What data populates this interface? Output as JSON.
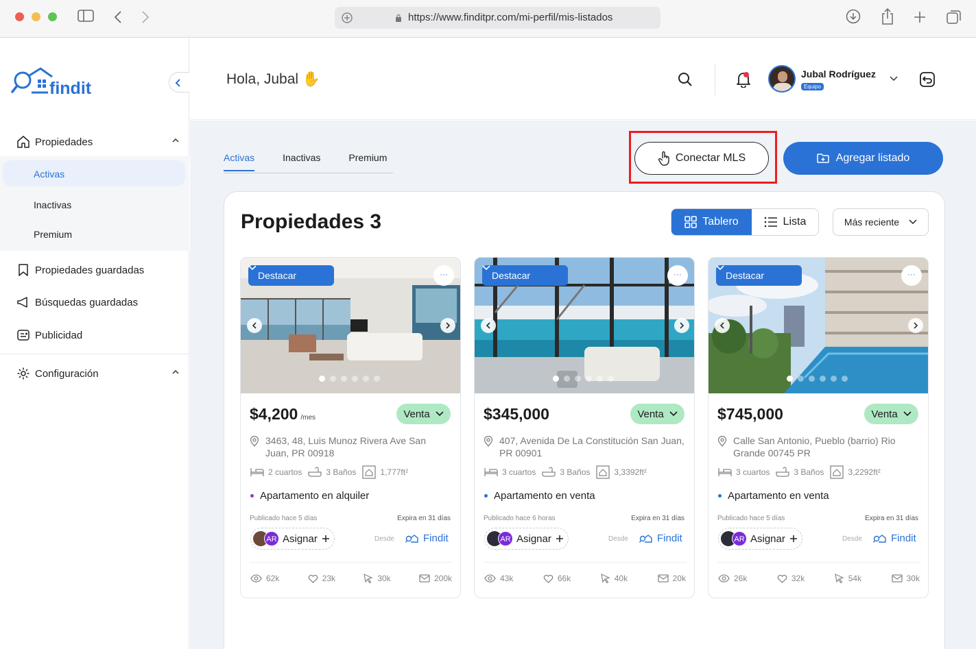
{
  "browser": {
    "url": "https://www.finditpr.com/mi-perfil/mis-listados"
  },
  "sidebar": {
    "logo_text": "findit",
    "nav": {
      "propiedades": "Propiedades",
      "sub": [
        "Activas",
        "Inactivas",
        "Premium"
      ],
      "guardadas": "Propiedades guardadas",
      "busquedas": "Búsquedas guardadas",
      "publicidad": "Publicidad",
      "config": "Configuración"
    }
  },
  "header": {
    "greeting": "Hola, Jubal",
    "greeting_emoji": "✋",
    "user_name": "Jubal Rodríguez",
    "user_badge": "Equipo"
  },
  "tabs": [
    "Activas",
    "Inactivas",
    "Premium"
  ],
  "actions": {
    "connect_mls": "Conectar MLS",
    "add_listing": "Agregar listado"
  },
  "panel": {
    "title": "Propiedades 3",
    "view_board": "Tablero",
    "view_list": "Lista",
    "sort": "Más reciente"
  },
  "cards": [
    {
      "feature": "Destacar",
      "price": "$4,200",
      "price_suffix": "/mes",
      "status": "Venta",
      "address": "3463, 48, Luis Munoz Rivera Ave San Juan, PR 00918",
      "rooms": "2 cuartos",
      "baths": "3 Baños",
      "area": "1,777ft²",
      "type": "Apartamento en alquiler",
      "type_color": "#8a3ad6",
      "published": "Publicado hace 5 días",
      "expires": "Expira en 31 días",
      "assign": "Asignar",
      "avatar_initials": "AR",
      "source_label": "Desde",
      "source": "Findit",
      "views": "62k",
      "likes": "23k",
      "clicks": "30k",
      "messages": "200k"
    },
    {
      "feature": "Destacar",
      "price": "$345,000",
      "price_suffix": "",
      "status": "Venta",
      "address": "407, Avenida De La Constitución San Juan, PR 00901",
      "rooms": "3 cuartos",
      "baths": "3 Baños",
      "area": "3,3392ft²",
      "type": "Apartamento en venta",
      "type_color": "#2a72d6",
      "published": "Publicado hace 6 horas",
      "expires": "Expira en 31 días",
      "assign": "Asignar",
      "avatar_initials": "AR",
      "source_label": "Desde",
      "source": "Findit",
      "views": "43k",
      "likes": "66k",
      "clicks": "40k",
      "messages": "20k"
    },
    {
      "feature": "Destacar",
      "price": "$745,000",
      "price_suffix": "",
      "status": "Venta",
      "address": "Calle San Antonio, Pueblo (barrio) Rio Grande 00745 PR",
      "rooms": "3 cuartos",
      "baths": "3 Baños",
      "area": "3,2292ft²",
      "type": "Apartamento en venta",
      "type_color": "#2a72d6",
      "published": "Publicado hace 5 días",
      "expires": "Expira en 31 días",
      "assign": "Asignar",
      "avatar_initials": "AR",
      "source_label": "Desde",
      "source": "Findit",
      "views": "26k",
      "likes": "32k",
      "clicks": "54k",
      "messages": "30k"
    }
  ]
}
